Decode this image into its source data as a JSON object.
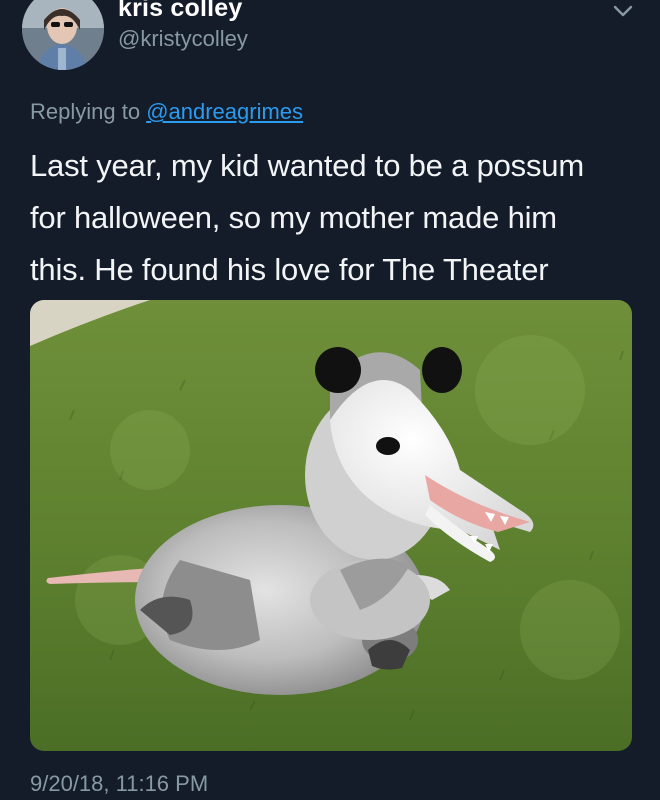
{
  "tweet": {
    "author": {
      "name": "kris colley",
      "handle": "@kristycolley"
    },
    "reply": {
      "prefix": "Replying to ",
      "to_handle": "@andreagrimes"
    },
    "text_lines": [
      "Last year, my kid wanted to be a possum",
      "for halloween, so my mother made him",
      "this. He found his love for The Theater"
    ],
    "media": {
      "content": "photo of a child in a possum costume sitting on grass"
    },
    "timestamp": "9/20/18, 11:16 PM",
    "more_icon": "chevron-down-icon"
  },
  "colors": {
    "background": "#141c29",
    "secondary_text": "#8899a6",
    "link": "#2b9bf0",
    "primary_text": "#f2f4f6"
  }
}
